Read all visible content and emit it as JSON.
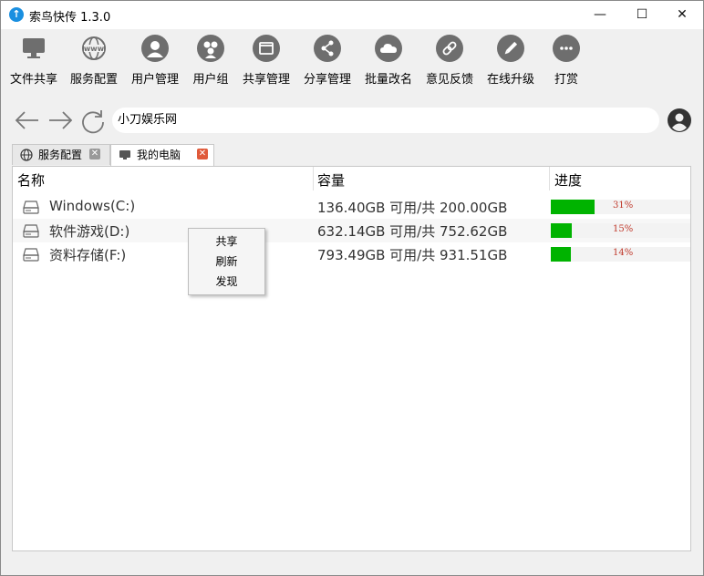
{
  "window": {
    "title": "索鸟快传 1.3.0",
    "app_icon": "upload-arrow-icon"
  },
  "window_controls": {
    "minimize": "—",
    "maximize": "☐",
    "close": "✕"
  },
  "toolbar": {
    "items": [
      {
        "label": "文件共享",
        "icon": "monitor-icon"
      },
      {
        "label": "服务配置",
        "icon": "www-globe-icon"
      },
      {
        "label": "用户管理",
        "icon": "user-icon"
      },
      {
        "label": "用户组",
        "icon": "user-group-icon"
      },
      {
        "label": "共享管理",
        "icon": "folder-icon"
      },
      {
        "label": "分享管理",
        "icon": "share-icon"
      },
      {
        "label": "批量改名",
        "icon": "cloud-icon"
      },
      {
        "label": "意见反馈",
        "icon": "link-icon"
      },
      {
        "label": "在线升级",
        "icon": "pencil-icon"
      },
      {
        "label": "打赏",
        "icon": "chat-icon"
      }
    ]
  },
  "nav": {
    "address": "小刀娱乐网"
  },
  "tabs": [
    {
      "label": "服务配置",
      "icon": "globe-icon",
      "active": false
    },
    {
      "label": "我的电脑",
      "icon": "monitor-icon",
      "active": true
    }
  ],
  "table": {
    "headers": {
      "name": "名称",
      "capacity": "容量",
      "progress": "进度"
    },
    "rows": [
      {
        "name": "Windows(C:)",
        "capacity": "136.40GB 可用/共 200.00GB",
        "percent_label": "31%",
        "percent": 31
      },
      {
        "name": "软件游戏(D:)",
        "capacity": "632.14GB 可用/共 752.62GB",
        "percent_label": "15%",
        "percent": 15
      },
      {
        "name": "资料存储(F:)",
        "capacity": "793.49GB 可用/共 931.51GB",
        "percent_label": "14%",
        "percent": 14
      }
    ]
  },
  "context_menu": {
    "items": [
      "共享",
      "刷新",
      "发现"
    ]
  },
  "colors": {
    "progress_fill": "#00b300",
    "percent_text": "#c0392b",
    "tab_close_active": "#e05a3a",
    "app_icon": "#1a8fe0"
  }
}
